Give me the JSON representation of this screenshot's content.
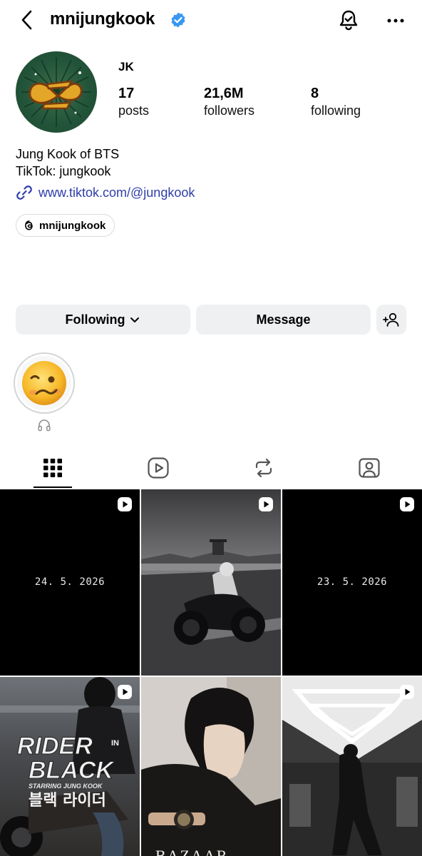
{
  "header": {
    "username": "mnijungkook",
    "verified": true
  },
  "profile": {
    "display_name": "JK",
    "stats": [
      {
        "value": "17",
        "label": "posts"
      },
      {
        "value": "21,6M",
        "label": "followers"
      },
      {
        "value": "8",
        "label": "following"
      }
    ],
    "bio_lines": [
      "Jung Kook of BTS",
      "TikTok: jungkook"
    ],
    "link": "www.tiktok.com/@jungkook",
    "threads_handle": "mnijungkook"
  },
  "actions": {
    "following_label": "Following",
    "message_label": "Message"
  },
  "tabs": [
    {
      "icon": "grid-icon",
      "active": true
    },
    {
      "icon": "reels-icon",
      "active": false
    },
    {
      "icon": "repost-icon",
      "active": false
    },
    {
      "icon": "tagged-icon",
      "active": false
    }
  ],
  "posts": [
    {
      "type": "reel",
      "text": "24. 5. 2026"
    },
    {
      "type": "reel",
      "text": ""
    },
    {
      "type": "reel",
      "text": "23. 5. 2026"
    },
    {
      "type": "reel",
      "text": "",
      "overlay": [
        "RIDER",
        "IN",
        "BLACK",
        "STARRING JUNG KOOK",
        "블랙 라이더"
      ]
    },
    {
      "type": "image",
      "text": "",
      "overlay": [
        "BAZAAR"
      ]
    },
    {
      "type": "reel",
      "text": ""
    }
  ],
  "colors": {
    "verified": "#3897f0",
    "link": "#2f3ea8",
    "button_bg": "#eff0f2",
    "avatar_bg": "#23553a"
  }
}
